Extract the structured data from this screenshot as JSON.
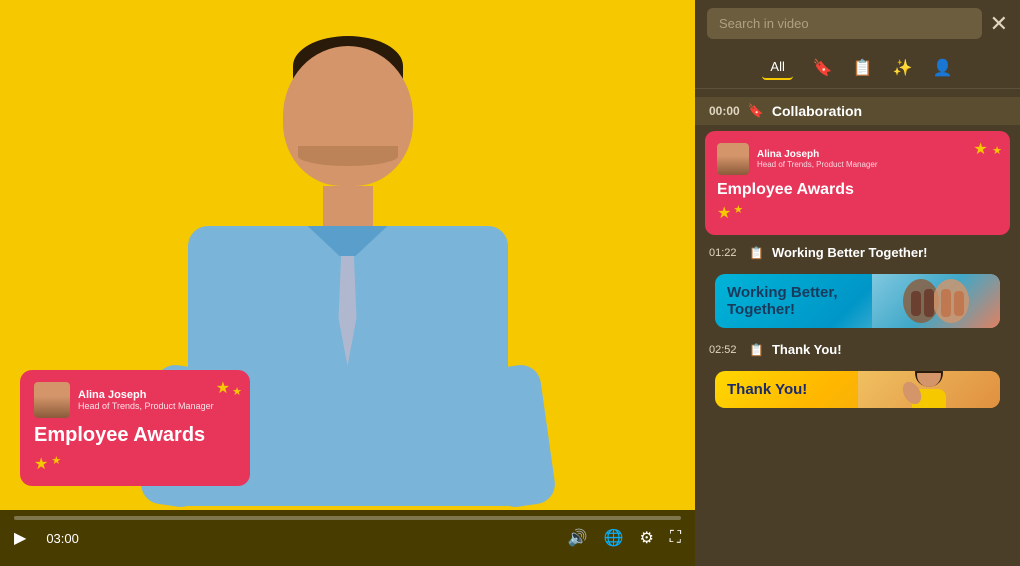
{
  "video": {
    "time_current": "03:00",
    "progress_pct": 0,
    "overlay_card": {
      "name": "Alina Joseph",
      "title": "Head of Trends, Product Manager",
      "main_title": "Employee Awards"
    }
  },
  "controls": {
    "play_label": "▶",
    "time": "03:00",
    "volume_icon": "🔊",
    "globe_icon": "🌐",
    "gear_icon": "⚙",
    "fullscreen_icon": "⛶"
  },
  "search": {
    "placeholder": "Search in video",
    "close_label": "✕"
  },
  "filter_tabs": [
    {
      "label": "All",
      "active": true
    },
    {
      "label": "🔖",
      "active": false
    },
    {
      "label": "📋",
      "active": false
    },
    {
      "label": "✨",
      "active": false
    },
    {
      "label": "👤",
      "active": false
    }
  ],
  "sections": [
    {
      "time": "00:00",
      "icon": "🔖",
      "title": "Collaboration",
      "segments": [
        {
          "type": "employee-awards",
          "name": "Alina Joseph",
          "subtitle": "Head of Trends, Product Manager",
          "main_title": "Employee Awards"
        }
      ]
    },
    {
      "time": "01:22",
      "icon": "📋",
      "title": "Working Better Together!",
      "segments": [
        {
          "type": "working-together",
          "text": "Working Better, Together!"
        }
      ]
    },
    {
      "time": "02:52",
      "icon": "📋",
      "title": "Thank You!",
      "segments": [
        {
          "type": "thank-you",
          "text": "Thank You!"
        }
      ]
    }
  ]
}
